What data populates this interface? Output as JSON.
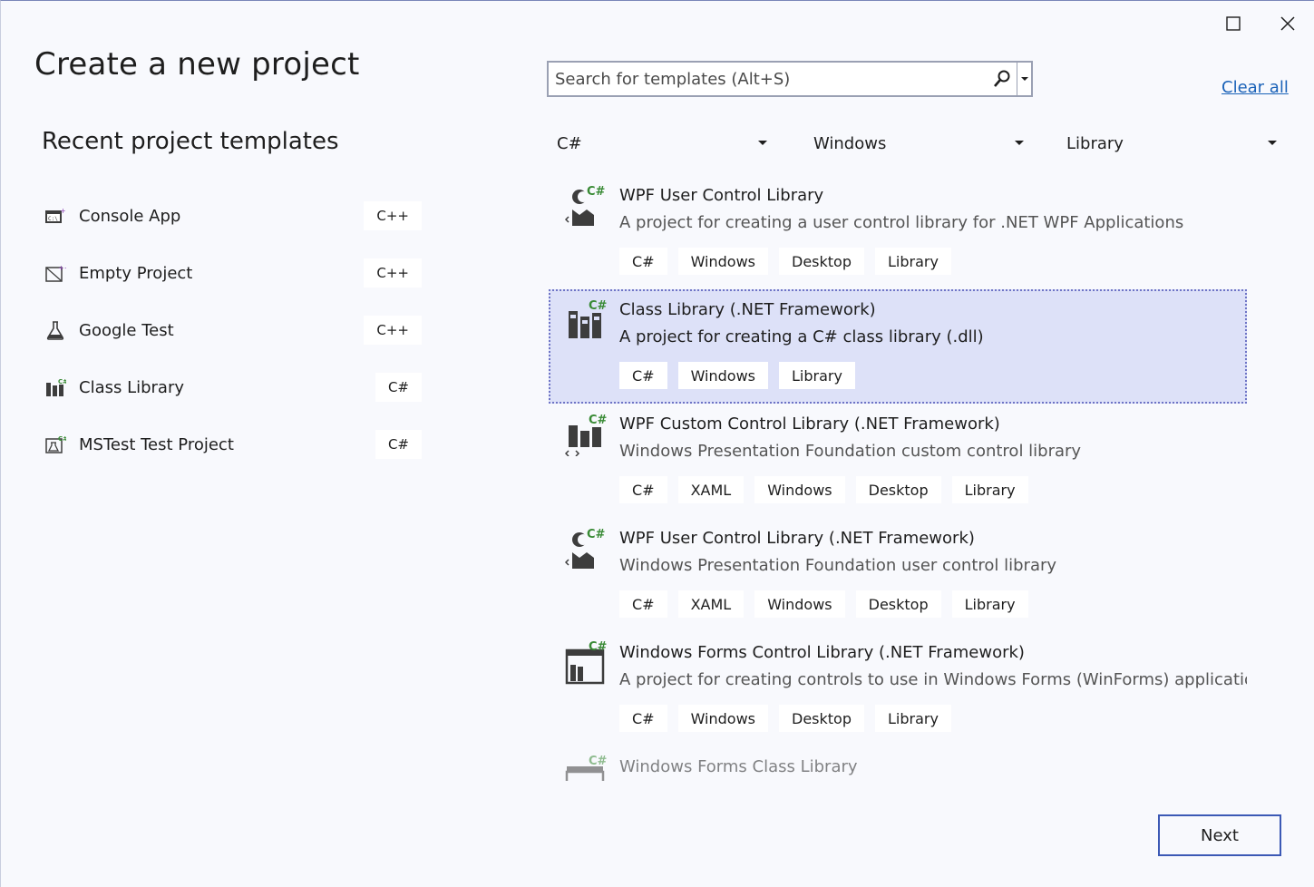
{
  "header": {
    "title": "Create a new project",
    "window_controls": {
      "maximize": "maximize-icon",
      "close": "close-icon"
    }
  },
  "recent": {
    "heading": "Recent project templates",
    "items": [
      {
        "label": "Console App",
        "lang": "C++",
        "icon": "console-app-icon"
      },
      {
        "label": "Empty Project",
        "lang": "C++",
        "icon": "empty-project-icon"
      },
      {
        "label": "Google Test",
        "lang": "C++",
        "icon": "flask-icon"
      },
      {
        "label": "Class Library",
        "lang": "C#",
        "icon": "class-library-icon"
      },
      {
        "label": "MSTest Test Project",
        "lang": "C#",
        "icon": "test-project-icon"
      }
    ]
  },
  "search": {
    "placeholder": "Search for templates (Alt+S)",
    "value": ""
  },
  "clear_all": "Clear all",
  "filters": {
    "language": "C#",
    "platform": "Windows",
    "project_type": "Library"
  },
  "templates": [
    {
      "name": "WPF User Control Library",
      "description": "A project for creating a user control library for .NET WPF Applications",
      "tags": [
        "C#",
        "Windows",
        "Desktop",
        "Library"
      ],
      "icon": "wpf-user-control-icon",
      "selected": false
    },
    {
      "name": "Class Library (.NET Framework)",
      "description": "A project for creating a C# class library (.dll)",
      "tags": [
        "C#",
        "Windows",
        "Library"
      ],
      "icon": "class-library-icon",
      "selected": true
    },
    {
      "name": "WPF Custom Control Library (.NET Framework)",
      "description": "Windows Presentation Foundation custom control library",
      "tags": [
        "C#",
        "XAML",
        "Windows",
        "Desktop",
        "Library"
      ],
      "icon": "wpf-custom-control-icon",
      "selected": false
    },
    {
      "name": "WPF User Control Library (.NET Framework)",
      "description": "Windows Presentation Foundation user control library",
      "tags": [
        "C#",
        "XAML",
        "Windows",
        "Desktop",
        "Library"
      ],
      "icon": "wpf-user-control-icon",
      "selected": false
    },
    {
      "name": "Windows Forms Control Library (.NET Framework)",
      "description": "A project for creating controls to use in Windows Forms (WinForms) applications",
      "tags": [
        "C#",
        "Windows",
        "Desktop",
        "Library"
      ],
      "icon": "winforms-control-icon",
      "selected": false
    },
    {
      "name": "Windows Forms Class Library",
      "description": "",
      "tags": [],
      "icon": "winforms-class-library-icon",
      "selected": false
    }
  ],
  "footer": {
    "next_label": "Next"
  },
  "colors": {
    "background": "#f8f9fd",
    "selection": "#dde1f8",
    "link": "#1a62b8",
    "accent_border": "#3c59b5",
    "csharp_badge": "#388a34"
  }
}
